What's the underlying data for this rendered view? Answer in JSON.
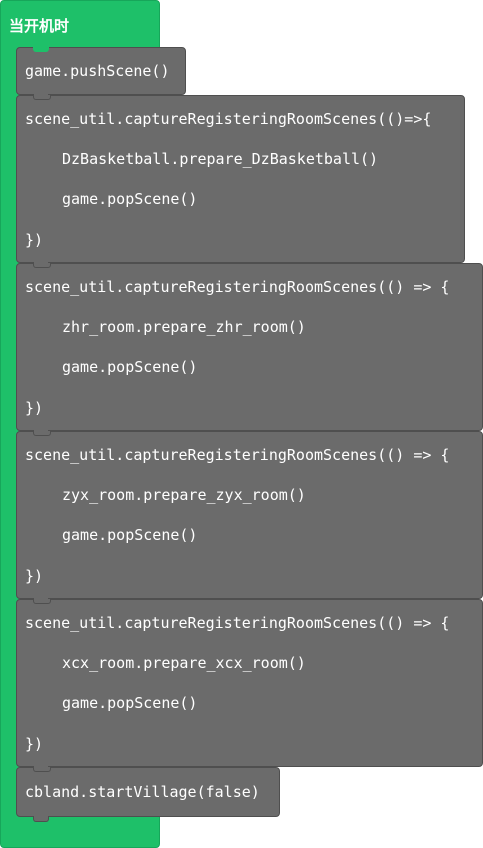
{
  "event": {
    "label": "当开机时"
  },
  "blocks": [
    {
      "lines": [
        "game.pushScene()"
      ]
    },
    {
      "lines": [
        "scene_util.captureRegisteringRoomScenes(()=>{",
        "DzBasketball.prepare_DzBasketball()",
        "game.popScene()",
        "})"
      ]
    },
    {
      "lines": [
        "scene_util.captureRegisteringRoomScenes(() => {",
        "zhr_room.prepare_zhr_room()",
        "game.popScene()",
        "})"
      ]
    },
    {
      "lines": [
        "scene_util.captureRegisteringRoomScenes(() => {",
        "zyx_room.prepare_zyx_room()",
        "game.popScene()",
        "})"
      ]
    },
    {
      "lines": [
        "scene_util.captureRegisteringRoomScenes(() => {",
        "xcx_room.prepare_xcx_room()",
        "game.popScene()",
        "})"
      ]
    },
    {
      "lines": [
        "cbland.startVillage(false)"
      ]
    }
  ],
  "colors": {
    "event_green": "#1ec069",
    "block_grey": "#6b6b6b",
    "text": "#ffffff"
  }
}
